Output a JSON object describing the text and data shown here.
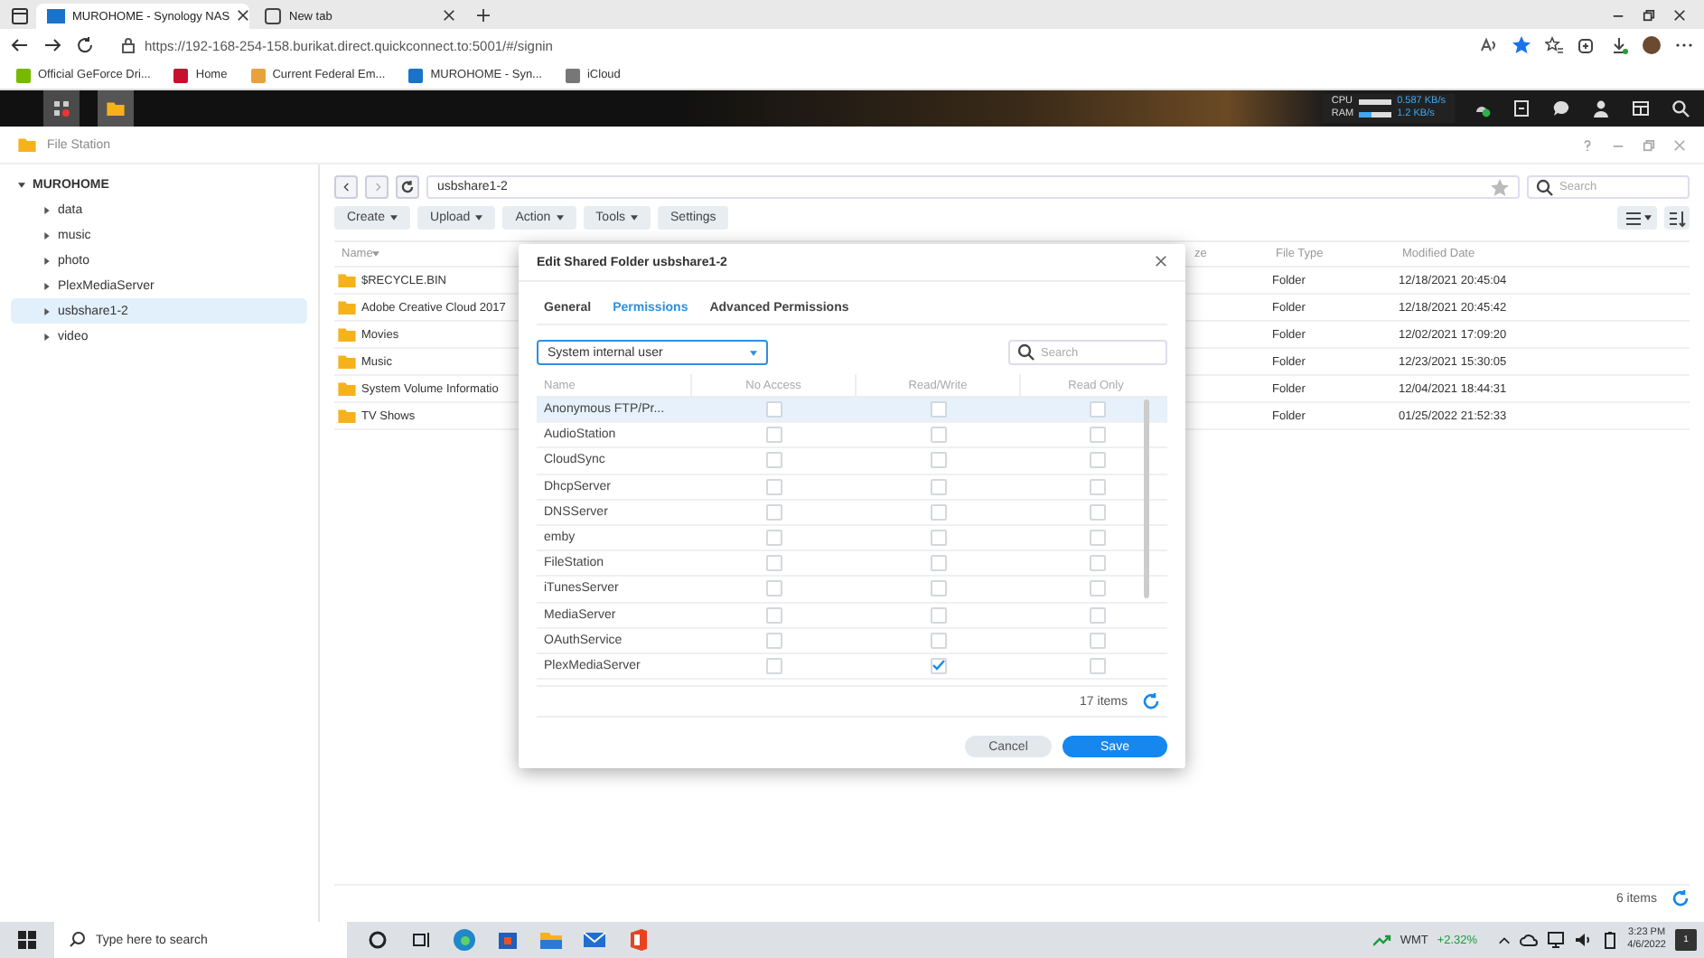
{
  "browser": {
    "tabs": [
      {
        "title": "MUROHOME - Synology NAS",
        "selected": true
      },
      {
        "title": "New tab",
        "selected": false
      }
    ],
    "url": "https://192-168-254-158.burikat.direct.quickconnect.to:5001/#/signin",
    "bookmarks": [
      "Official GeForce Dri...",
      "Home",
      "Current Federal Em...",
      "MUROHOME - Syn...",
      "iCloud"
    ]
  },
  "dsm": {
    "cpu_label": "CPU",
    "ram_label": "RAM",
    "upload": "0.587 KB/s",
    "download": "1.2 KB/s"
  },
  "file_station": {
    "title": "File Station",
    "tree": {
      "label": "MUROHOME",
      "expanded": true,
      "children": [
        {
          "label": "data",
          "selected": false
        },
        {
          "label": "music",
          "selected": false
        },
        {
          "label": "photo",
          "selected": false
        },
        {
          "label": "PlexMediaServer",
          "selected": false
        },
        {
          "label": "usbshare1-2",
          "selected": true
        },
        {
          "label": "video",
          "selected": false
        }
      ]
    },
    "path": "usbshare1-2",
    "search_placeholder": "Search",
    "toolbar": [
      {
        "label": "Create",
        "menu": true
      },
      {
        "label": "Upload",
        "menu": true
      },
      {
        "label": "Action",
        "menu": true
      },
      {
        "label": "Tools",
        "menu": true
      },
      {
        "label": "Settings",
        "menu": false
      }
    ],
    "columns": {
      "name": "Name",
      "column_2": "ze",
      "type": "File Type",
      "modified": "Modified Date"
    },
    "rows": [
      {
        "name": "$RECYCLE.BIN",
        "type": "Folder",
        "modified": "12/18/2021 20:45:04"
      },
      {
        "name": "Adobe Creative Cloud 2017",
        "type": "Folder",
        "modified": "12/18/2021 20:45:42"
      },
      {
        "name": "Movies",
        "type": "Folder",
        "modified": "12/02/2021 17:09:20"
      },
      {
        "name": "Music",
        "type": "Folder",
        "modified": "12/23/2021 15:30:05"
      },
      {
        "name": "System Volume Informatio",
        "type": "Folder",
        "modified": "12/04/2021 18:44:31"
      },
      {
        "name": "TV Shows",
        "type": "Folder",
        "modified": "01/25/2022 21:52:33"
      }
    ],
    "status": "6 items"
  },
  "dialog": {
    "title": "Edit Shared Folder usbshare1-2",
    "tabs": [
      {
        "label": "General",
        "selected": false
      },
      {
        "label": "Permissions",
        "selected": true
      },
      {
        "label": "Advanced Permissions",
        "selected": false
      }
    ],
    "user_type": "System internal user",
    "search_placeholder": "Search",
    "columns": [
      "Name",
      "No Access",
      "Read/Write",
      "Read Only"
    ],
    "rows": [
      {
        "name": "Anonymous FTP/Pr...",
        "selected": true,
        "no_access": false,
        "read_write": false,
        "read_only": false
      },
      {
        "name": "AudioStation",
        "selected": false,
        "no_access": false,
        "read_write": false,
        "read_only": false
      },
      {
        "name": "CloudSync",
        "selected": false,
        "no_access": false,
        "read_write": false,
        "read_only": false
      },
      {
        "name": "DhcpServer",
        "selected": false,
        "no_access": false,
        "read_write": false,
        "read_only": false
      },
      {
        "name": "DNSServer",
        "selected": false,
        "no_access": false,
        "read_write": false,
        "read_only": false
      },
      {
        "name": "emby",
        "selected": false,
        "no_access": false,
        "read_write": false,
        "read_only": false
      },
      {
        "name": "FileStation",
        "selected": false,
        "no_access": false,
        "read_write": false,
        "read_only": false
      },
      {
        "name": "iTunesServer",
        "selected": false,
        "no_access": false,
        "read_write": false,
        "read_only": false
      },
      {
        "name": "MediaServer",
        "selected": false,
        "no_access": false,
        "read_write": false,
        "read_only": false
      },
      {
        "name": "OAuthService",
        "selected": false,
        "no_access": false,
        "read_write": false,
        "read_only": false
      },
      {
        "name": "PlexMediaServer",
        "selected": false,
        "no_access": false,
        "read_write": true,
        "read_only": false
      }
    ],
    "count": "17 items",
    "buttons": [
      {
        "label": "Cancel",
        "kind": "secondary"
      },
      {
        "label": "Save",
        "kind": "primary"
      }
    ]
  },
  "taskbar": {
    "search_placeholder": "Type here to search",
    "ticker": "WMT",
    "change": "+2.32%",
    "time": "3:23 PM",
    "date": "4/6/2022",
    "notifications": "1"
  }
}
